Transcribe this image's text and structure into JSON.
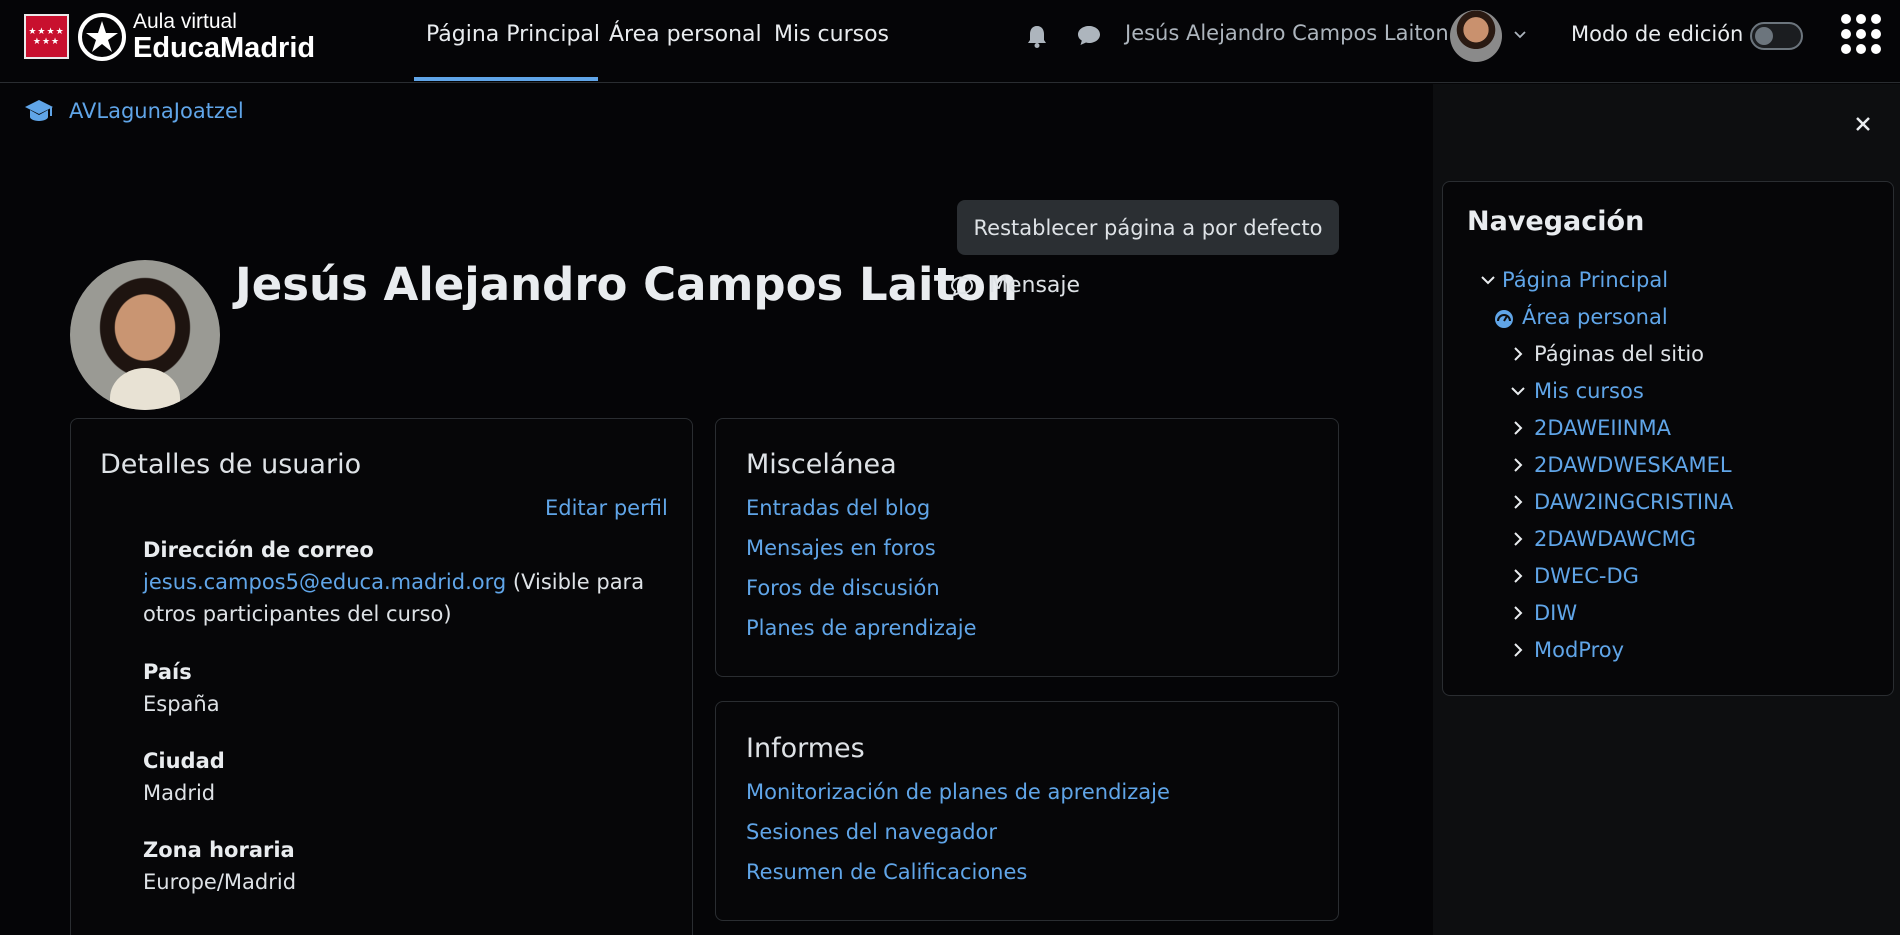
{
  "header": {
    "logo_line1": "Aula virtual",
    "logo_line2": "EducaMadrid",
    "logo_flag_stars": "★★★★ ★★★",
    "nav": [
      "Página Principal",
      "Área personal",
      "Mis cursos"
    ],
    "user_name": "Jesús Alejandro Campos Laiton",
    "edit_mode_label": "Modo de edición"
  },
  "breadcrumb": {
    "label": "AVLagunaJoatzel"
  },
  "reset_button": "Restablecer página a por defecto",
  "profile": {
    "name": "Jesús Alejandro Campos Laiton",
    "message_label": "Mensaje"
  },
  "user_details": {
    "title": "Detalles de usuario",
    "edit_link": "Editar perfil",
    "email_label": "Dirección de correo",
    "email_value": "jesus.campos5@educa.madrid.org",
    "email_note_1": "(Visible para",
    "email_note_2": "otros participantes del curso)",
    "country_label": "País",
    "country_value": "España",
    "city_label": "Ciudad",
    "city_value": "Madrid",
    "tz_label": "Zona horaria",
    "tz_value": "Europe/Madrid"
  },
  "misc": {
    "title": "Miscelánea",
    "links": [
      "Entradas del blog",
      "Mensajes en foros",
      "Foros de discusión",
      "Planes de aprendizaje"
    ]
  },
  "reports": {
    "title": "Informes",
    "links": [
      "Monitorización de planes de aprendizaje",
      "Sesiones del navegador",
      "Resumen de Calificaciones"
    ]
  },
  "navigation": {
    "title": "Navegación",
    "home": "Página Principal",
    "dashboard": "Área personal",
    "site_pages": "Páginas del sitio",
    "my_courses": "Mis cursos",
    "courses": [
      "2DAWEIINMA",
      "2DAWDWESKAMEL",
      "DAW2INGCRISTINA",
      "2DAWDAWCMG",
      "DWEC-DG",
      "DIW",
      "ModProy"
    ]
  },
  "colors": {
    "link": "#60a5e8",
    "background": "#050507",
    "drawer": "#0d0e10"
  }
}
